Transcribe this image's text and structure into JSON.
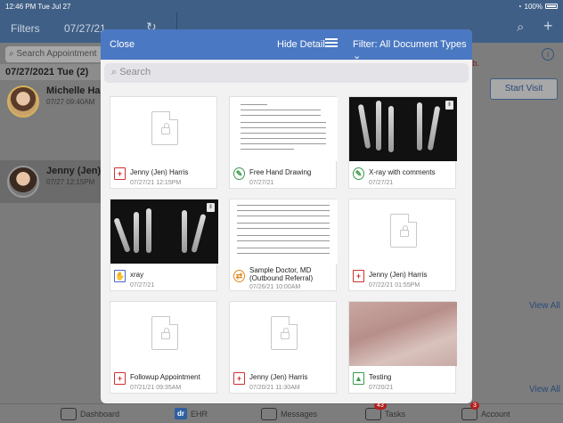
{
  "status": {
    "time": "12:46 PM",
    "day": "Tue Jul 27",
    "battery": "100%"
  },
  "nav": {
    "filters": "Filters",
    "date": "07/27/21",
    "search_icon": "search-icon",
    "add_icon": "plus-icon"
  },
  "left": {
    "search_placeholder": "Search Appointment",
    "group": "07/27/2021 Tue (2)",
    "appointments": [
      {
        "name": "Michelle Harris",
        "time": "07/27 09:40AM"
      },
      {
        "name": "Jenny (Jen) H",
        "time": "07/27 12:15PM"
      }
    ]
  },
  "right": {
    "tab_text": "t tab.",
    "start_visit": "Start Visit",
    "view_all_1": "View All",
    "view_all_2": "View All"
  },
  "modal": {
    "close": "Close",
    "hide_detail": "Hide Detail",
    "filter": "Filter: All Document Types",
    "search_placeholder": "Search",
    "cards": [
      {
        "title": "Jenny (Jen) Harris",
        "date": "07/27/21 12:15PM",
        "type": "pdf"
      },
      {
        "title": "Free Hand Drawing",
        "date": "07/27/21",
        "type": "drawing"
      },
      {
        "title": "X-ray with comments",
        "date": "07/27/21",
        "type": "drawing"
      },
      {
        "title": "xray",
        "date": "07/27/21",
        "type": "xray"
      },
      {
        "title": "Sample Doctor, MD (Outbound Referral)",
        "date": "07/26/21 10:00AM",
        "type": "referral"
      },
      {
        "title": "Jenny (Jen) Harris",
        "date": "07/22/21 01:55PM",
        "type": "pdf"
      },
      {
        "title": "Followup Appointment",
        "date": "07/21/21 09:35AM",
        "type": "pdf"
      },
      {
        "title": "Jenny (Jen) Harris",
        "date": "07/20/21 11:30AM",
        "type": "pdf"
      },
      {
        "title": "Testing",
        "date": "07/20/21",
        "type": "image"
      }
    ]
  },
  "tabbar": {
    "dashboard": "Dashboard",
    "ehr_badge": "dr",
    "ehr": "EHR",
    "messages": "Messages",
    "tasks": "Tasks",
    "tasks_count": "43",
    "account": "Account",
    "account_count": "3"
  }
}
